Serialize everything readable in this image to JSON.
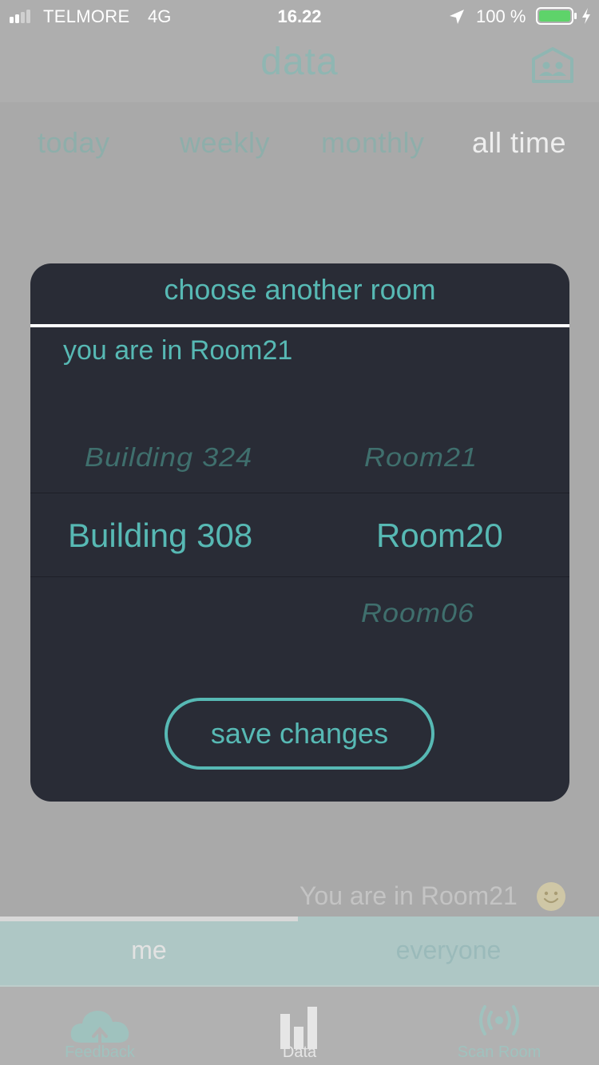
{
  "status_bar": {
    "carrier": "TELMORE",
    "network": "4G",
    "time": "16.22",
    "battery_percent": "100 %",
    "battery_level": 1.0,
    "signal_bars": 2
  },
  "header": {
    "title": "data",
    "right_icon": "room-id-badge-icon"
  },
  "period_tabs": [
    {
      "label": "today",
      "active": false
    },
    {
      "label": "weekly",
      "active": false
    },
    {
      "label": "monthly",
      "active": false
    },
    {
      "label": "all time",
      "active": true
    }
  ],
  "modal": {
    "title": "choose another room",
    "current_room_text": "you are in Room21",
    "building_options": {
      "above": "Building 324",
      "selected": "Building 308"
    },
    "room_options": {
      "above": "Room21",
      "selected": "Room20",
      "below": "Room06"
    },
    "save_label": "save changes"
  },
  "room_status": {
    "text": "You are in Room21",
    "icon": "smiley-face-icon"
  },
  "segments": [
    {
      "label": "me",
      "active": true
    },
    {
      "label": "everyone",
      "active": false
    }
  ],
  "tab_bar": [
    {
      "label": "Feedback",
      "icon": "cloud-upload-icon",
      "active": false
    },
    {
      "label": "Data",
      "icon": "bar-chart-icon",
      "active": true
    },
    {
      "label": "Scan Room",
      "icon": "broadcast-icon",
      "active": false
    }
  ],
  "colors": {
    "accent": "#57b9b4",
    "modal_background": "#292c36",
    "overlay": "#aeaeae"
  }
}
